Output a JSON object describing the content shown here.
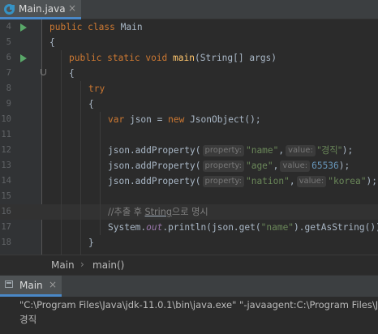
{
  "editor_tab": {
    "file_name": "Main.java",
    "close": "×",
    "icon": "java-class-icon"
  },
  "code_lines": [
    {
      "num": "4"
    },
    {
      "num": "5"
    },
    {
      "num": "6"
    },
    {
      "num": "7"
    },
    {
      "num": "8"
    },
    {
      "num": "9"
    },
    {
      "num": "10"
    },
    {
      "num": "11"
    },
    {
      "num": "12"
    },
    {
      "num": "13"
    },
    {
      "num": "14"
    },
    {
      "num": "15"
    },
    {
      "num": "16"
    },
    {
      "num": "17"
    },
    {
      "num": "18"
    }
  ],
  "code": {
    "l4": {
      "kw1": "public",
      "kw2": "class",
      "name": "Main"
    },
    "l5": {
      "text": "{"
    },
    "l6": {
      "kw1": "public",
      "kw2": "static",
      "kw3": "void",
      "fn": "main",
      "params": "(String[] args)"
    },
    "l7": {
      "text": "{"
    },
    "l8": {
      "kw": "try"
    },
    "l9": {
      "text": "{"
    },
    "l10": {
      "kw1": "var",
      "mid": " json = ",
      "kw2": "new",
      "rest": " JsonObject();"
    },
    "l12": {
      "call": "json.addProperty(",
      "hint1": "property:",
      "arg1": "\"name\"",
      "comma": ",",
      "hint2": "value:",
      "arg2": "\"경직\"",
      "end": ");"
    },
    "l13": {
      "call": "json.addProperty(",
      "hint1": "property:",
      "arg1": "\"age\"",
      "comma": ",",
      "hint2": "value:",
      "arg2": "65536",
      "end": ");"
    },
    "l14": {
      "call": "json.addProperty(",
      "hint1": "property:",
      "arg1": "\"nation\"",
      "comma": ",",
      "hint2": "value:",
      "arg2": "\"korea\"",
      "end": ");"
    },
    "l16": {
      "c1": "//추출 후 ",
      "c2": "String",
      "c3": "으로 명시"
    },
    "l17": {
      "p1": "System.",
      "fld": "out",
      "p2": ".println(json.get(",
      "str": "\"name\"",
      "p3": ").getAsString());"
    },
    "l18": {
      "text": "}"
    }
  },
  "breadcrumb": {
    "items": [
      "Main",
      "main()"
    ],
    "separator": "›"
  },
  "run_panel": {
    "tab_label": "Main",
    "close": "×",
    "command": "\"C:\\Program Files\\Java\\jdk-11.0.1\\bin\\java.exe\" \"-javaagent:C:\\Program Files\\J",
    "output": "경직"
  },
  "colors": {
    "keyword": "#cc7832",
    "method": "#ffc66d",
    "string": "#6a8759",
    "number": "#6897bb",
    "field": "#9876aa",
    "comment": "#808080",
    "text": "#a9b7c6"
  }
}
